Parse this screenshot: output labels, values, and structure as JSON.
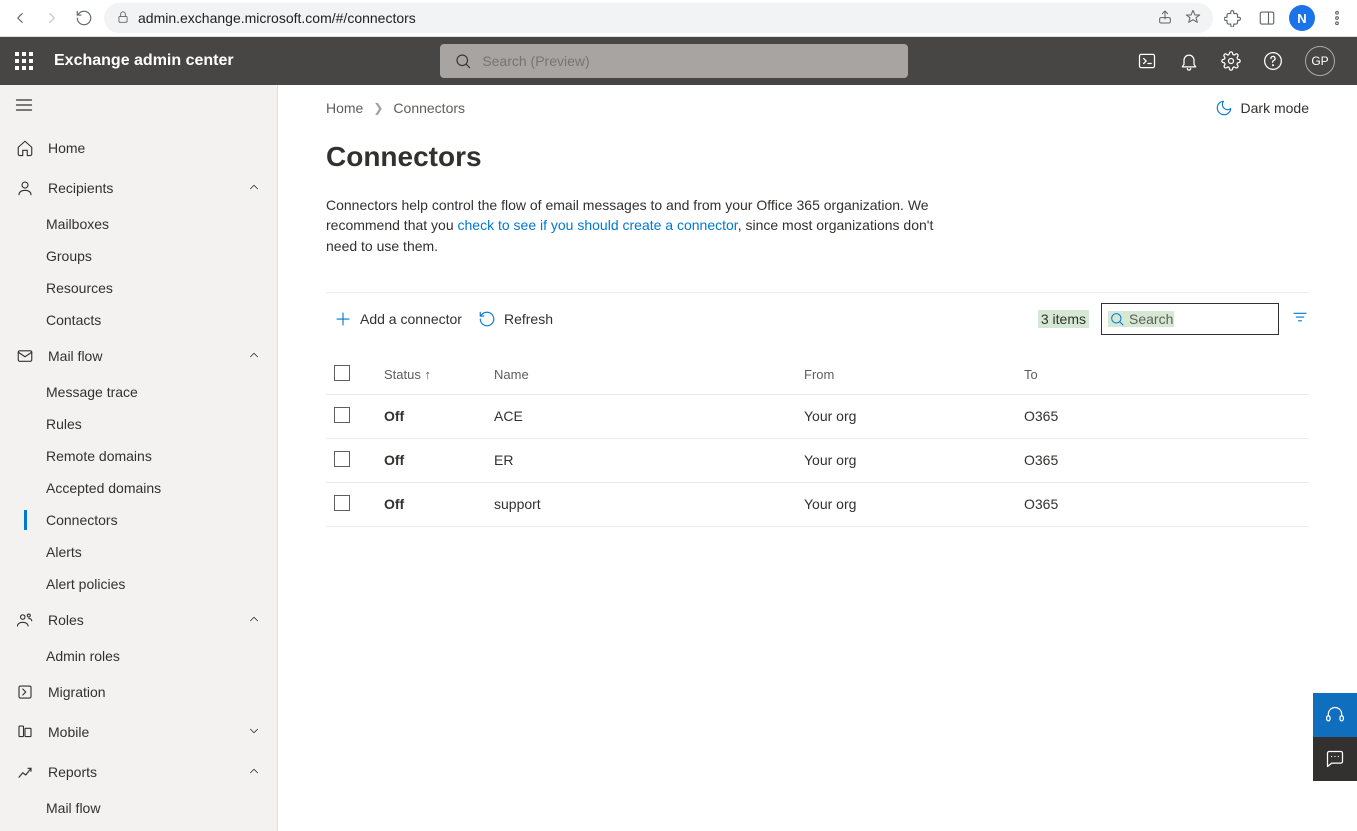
{
  "browser": {
    "url": "admin.exchange.microsoft.com/#/connectors",
    "profile_initial": "N"
  },
  "header": {
    "app_title": "Exchange admin center",
    "search_placeholder": "Search (Preview)",
    "account_initials": "GP"
  },
  "sidebar": {
    "items": [
      {
        "icon": "home",
        "label": "Home"
      },
      {
        "icon": "person",
        "label": "Recipients",
        "expanded": true,
        "children": [
          {
            "label": "Mailboxes"
          },
          {
            "label": "Groups"
          },
          {
            "label": "Resources"
          },
          {
            "label": "Contacts"
          }
        ]
      },
      {
        "icon": "mail",
        "label": "Mail flow",
        "expanded": true,
        "children": [
          {
            "label": "Message trace"
          },
          {
            "label": "Rules"
          },
          {
            "label": "Remote domains"
          },
          {
            "label": "Accepted domains"
          },
          {
            "label": "Connectors",
            "active": true
          },
          {
            "label": "Alerts"
          },
          {
            "label": "Alert policies"
          }
        ]
      },
      {
        "icon": "roles",
        "label": "Roles",
        "expanded": true,
        "children": [
          {
            "label": "Admin roles"
          }
        ]
      },
      {
        "icon": "migration",
        "label": "Migration"
      },
      {
        "icon": "mobile",
        "label": "Mobile",
        "expanded": false
      },
      {
        "icon": "reports",
        "label": "Reports",
        "expanded": true,
        "children": [
          {
            "label": "Mail flow"
          }
        ]
      }
    ]
  },
  "breadcrumb": {
    "home": "Home",
    "current": "Connectors"
  },
  "darkmode_label": "Dark mode",
  "page_title": "Connectors",
  "description": {
    "part1": "Connectors help control the flow of email messages to and from your Office 365 organization. We recommend that you ",
    "link": "check to see if you should create a connector",
    "part2": ", since most organizations don't need to use them."
  },
  "toolbar": {
    "add_label": "Add a connector",
    "refresh_label": "Refresh",
    "count_label": "3 items",
    "search_placeholder": "Search"
  },
  "table": {
    "columns": {
      "status": "Status",
      "name": "Name",
      "from": "From",
      "to": "To"
    },
    "rows": [
      {
        "status": "Off",
        "name": "ACE",
        "from": "Your org",
        "to": "O365"
      },
      {
        "status": "Off",
        "name": "ER",
        "from": "Your org",
        "to": "O365"
      },
      {
        "status": "Off",
        "name": "support",
        "from": "Your org",
        "to": "O365"
      }
    ]
  }
}
